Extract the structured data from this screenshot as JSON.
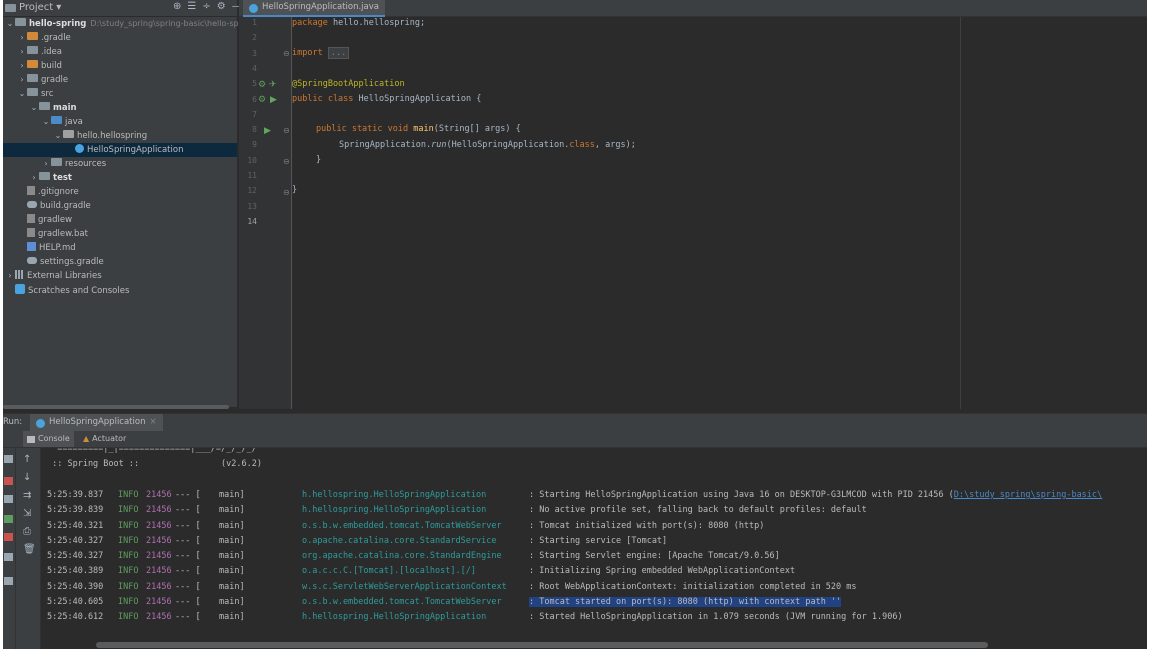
{
  "project_panel": {
    "title": "Project",
    "tree": [
      {
        "label": "hello-spring",
        "path": "D:\\study_spring\\spring-basic\\hello-sprin",
        "bold": true,
        "indent": 0,
        "arrow": "v",
        "icon": "folder-icon"
      },
      {
        "label": ".gradle",
        "indent": 1,
        "arrow": ">",
        "icon": "folder-icon-orange"
      },
      {
        "label": ".idea",
        "indent": 1,
        "arrow": ">",
        "icon": "folder-icon"
      },
      {
        "label": "build",
        "indent": 1,
        "arrow": ">",
        "icon": "folder-icon-orange"
      },
      {
        "label": "gradle",
        "indent": 1,
        "arrow": ">",
        "icon": "folder-icon"
      },
      {
        "label": "src",
        "indent": 1,
        "arrow": "v",
        "icon": "folder-icon"
      },
      {
        "label": "main",
        "indent": 2,
        "arrow": "v",
        "icon": "folder-icon",
        "bold": true
      },
      {
        "label": "java",
        "indent": 3,
        "arrow": "v",
        "icon": "folder-icon-blue"
      },
      {
        "label": "hello.hellospring",
        "indent": 4,
        "arrow": "v",
        "icon": "package-icon"
      },
      {
        "label": "HelloSpringApplication",
        "indent": 5,
        "arrow": "",
        "icon": "spring-class-icon",
        "selected": true
      },
      {
        "label": "resources",
        "indent": 3,
        "arrow": ">",
        "icon": "folder-icon"
      },
      {
        "label": "test",
        "indent": 2,
        "arrow": ">",
        "icon": "folder-icon",
        "bold": true
      },
      {
        "label": ".gitignore",
        "indent": 1,
        "arrow": "",
        "icon": "file-icon"
      },
      {
        "label": "build.gradle",
        "indent": 1,
        "arrow": "",
        "icon": "gradle-icon"
      },
      {
        "label": "gradlew",
        "indent": 1,
        "arrow": "",
        "icon": "file-icon"
      },
      {
        "label": "gradlew.bat",
        "indent": 1,
        "arrow": "",
        "icon": "file-icon"
      },
      {
        "label": "HELP.md",
        "indent": 1,
        "arrow": "",
        "icon": "markdown-icon"
      },
      {
        "label": "settings.gradle",
        "indent": 1,
        "arrow": "",
        "icon": "gradle-icon"
      },
      {
        "label": "External Libraries",
        "indent": 0,
        "arrow": ">",
        "icon": "library-icon"
      },
      {
        "label": "Scratches and Consoles",
        "indent": 0,
        "arrow": "",
        "icon": "scratch-icon"
      }
    ]
  },
  "editor": {
    "tab_label": "HelloSpringApplication.java",
    "line_numbers": [
      "1",
      "2",
      "3",
      "4",
      "5",
      "6",
      "7",
      "8",
      "9",
      "10",
      "11",
      "12",
      "13",
      "14"
    ],
    "current_line": "14",
    "code": {
      "l1_kw": "package",
      "l1_rest": " hello.hellospring;",
      "l3_kw": "import",
      "l3_fold": "...",
      "l6_ann": "@SpringBootApplication",
      "l7_kw": "public class",
      "l7_rest": " HelloSpringApplication {",
      "l9_kw": "public static void",
      "l9_fn": "main",
      "l9_rest": "(String[] args) {",
      "l10_a": "SpringApplication.",
      "l10_run": "run",
      "l10_b": "(HelloSpringApplication.",
      "l10_class": "class",
      "l10_c": ", args);",
      "l11": "}",
      "l13": "}"
    }
  },
  "run_panel": {
    "label": "Run:",
    "tab_label": "HelloSpringApplication",
    "subtabs": {
      "console": "Console",
      "actuator": "Actuator"
    },
    "banner_top": "  =========|_|==============|___/=/_/_/_/",
    "banner": " :: Spring Boot ::                (v2.6.2)",
    "logs": [
      {
        "ts": "5:25:39.837",
        "level": "INFO",
        "pid": "21456",
        "sep": "--- [",
        "thread": "main]",
        "logger": "h.hellospring.HelloSpringApplication",
        "msg": ": Starting HelloSpringApplication using Java 16 on DESKTOP-G3LMCOD with PID 21456 (",
        "link": "D:\\study_spring\\spring-basic\\"
      },
      {
        "ts": "5:25:39.839",
        "level": "INFO",
        "pid": "21456",
        "sep": "--- [",
        "thread": "main]",
        "logger": "h.hellospring.HelloSpringApplication",
        "msg": ": No active profile set, falling back to default profiles: default"
      },
      {
        "ts": "5:25:40.321",
        "level": "INFO",
        "pid": "21456",
        "sep": "--- [",
        "thread": "main]",
        "logger": "o.s.b.w.embedded.tomcat.TomcatWebServer",
        "msg": ": Tomcat initialized with port(s): 8080 (http)"
      },
      {
        "ts": "5:25:40.327",
        "level": "INFO",
        "pid": "21456",
        "sep": "--- [",
        "thread": "main]",
        "logger": "o.apache.catalina.core.StandardService",
        "msg": ": Starting service [Tomcat]"
      },
      {
        "ts": "5:25:40.327",
        "level": "INFO",
        "pid": "21456",
        "sep": "--- [",
        "thread": "main]",
        "logger": "org.apache.catalina.core.StandardEngine",
        "msg": ": Starting Servlet engine: [Apache Tomcat/9.0.56]"
      },
      {
        "ts": "5:25:40.389",
        "level": "INFO",
        "pid": "21456",
        "sep": "--- [",
        "thread": "main]",
        "logger": "o.a.c.c.C.[Tomcat].[localhost].[/]",
        "msg": ": Initializing Spring embedded WebApplicationContext"
      },
      {
        "ts": "5:25:40.390",
        "level": "INFO",
        "pid": "21456",
        "sep": "--- [",
        "thread": "main]",
        "logger": "w.s.c.ServletWebServerApplicationContext",
        "msg": ": Root WebApplicationContext: initialization completed in 520 ms"
      },
      {
        "ts": "5:25:40.605",
        "level": "INFO",
        "pid": "21456",
        "sep": "--- [",
        "thread": "main]",
        "logger": "o.s.b.w.embedded.tomcat.TomcatWebServer",
        "msg": ": Tomcat started on port(s): 8080 (http) with context path ''",
        "highlight": true
      },
      {
        "ts": "5:25:40.612",
        "level": "INFO",
        "pid": "21456",
        "sep": "--- [",
        "thread": "main]",
        "logger": "h.hellospring.HelloSpringApplication",
        "msg": ": Started HelloSpringApplication in 1.079 seconds (JVM running for 1.906)"
      }
    ]
  },
  "colors": {
    "background": "#2b2b2b",
    "panel": "#3c3f41",
    "keyword": "#cc7832",
    "annotation": "#bbb529",
    "method": "#ffc66d",
    "logger": "#2f9c9c",
    "info": "#5f9c5f",
    "pid": "#b06fb0",
    "selection": "#214283"
  }
}
